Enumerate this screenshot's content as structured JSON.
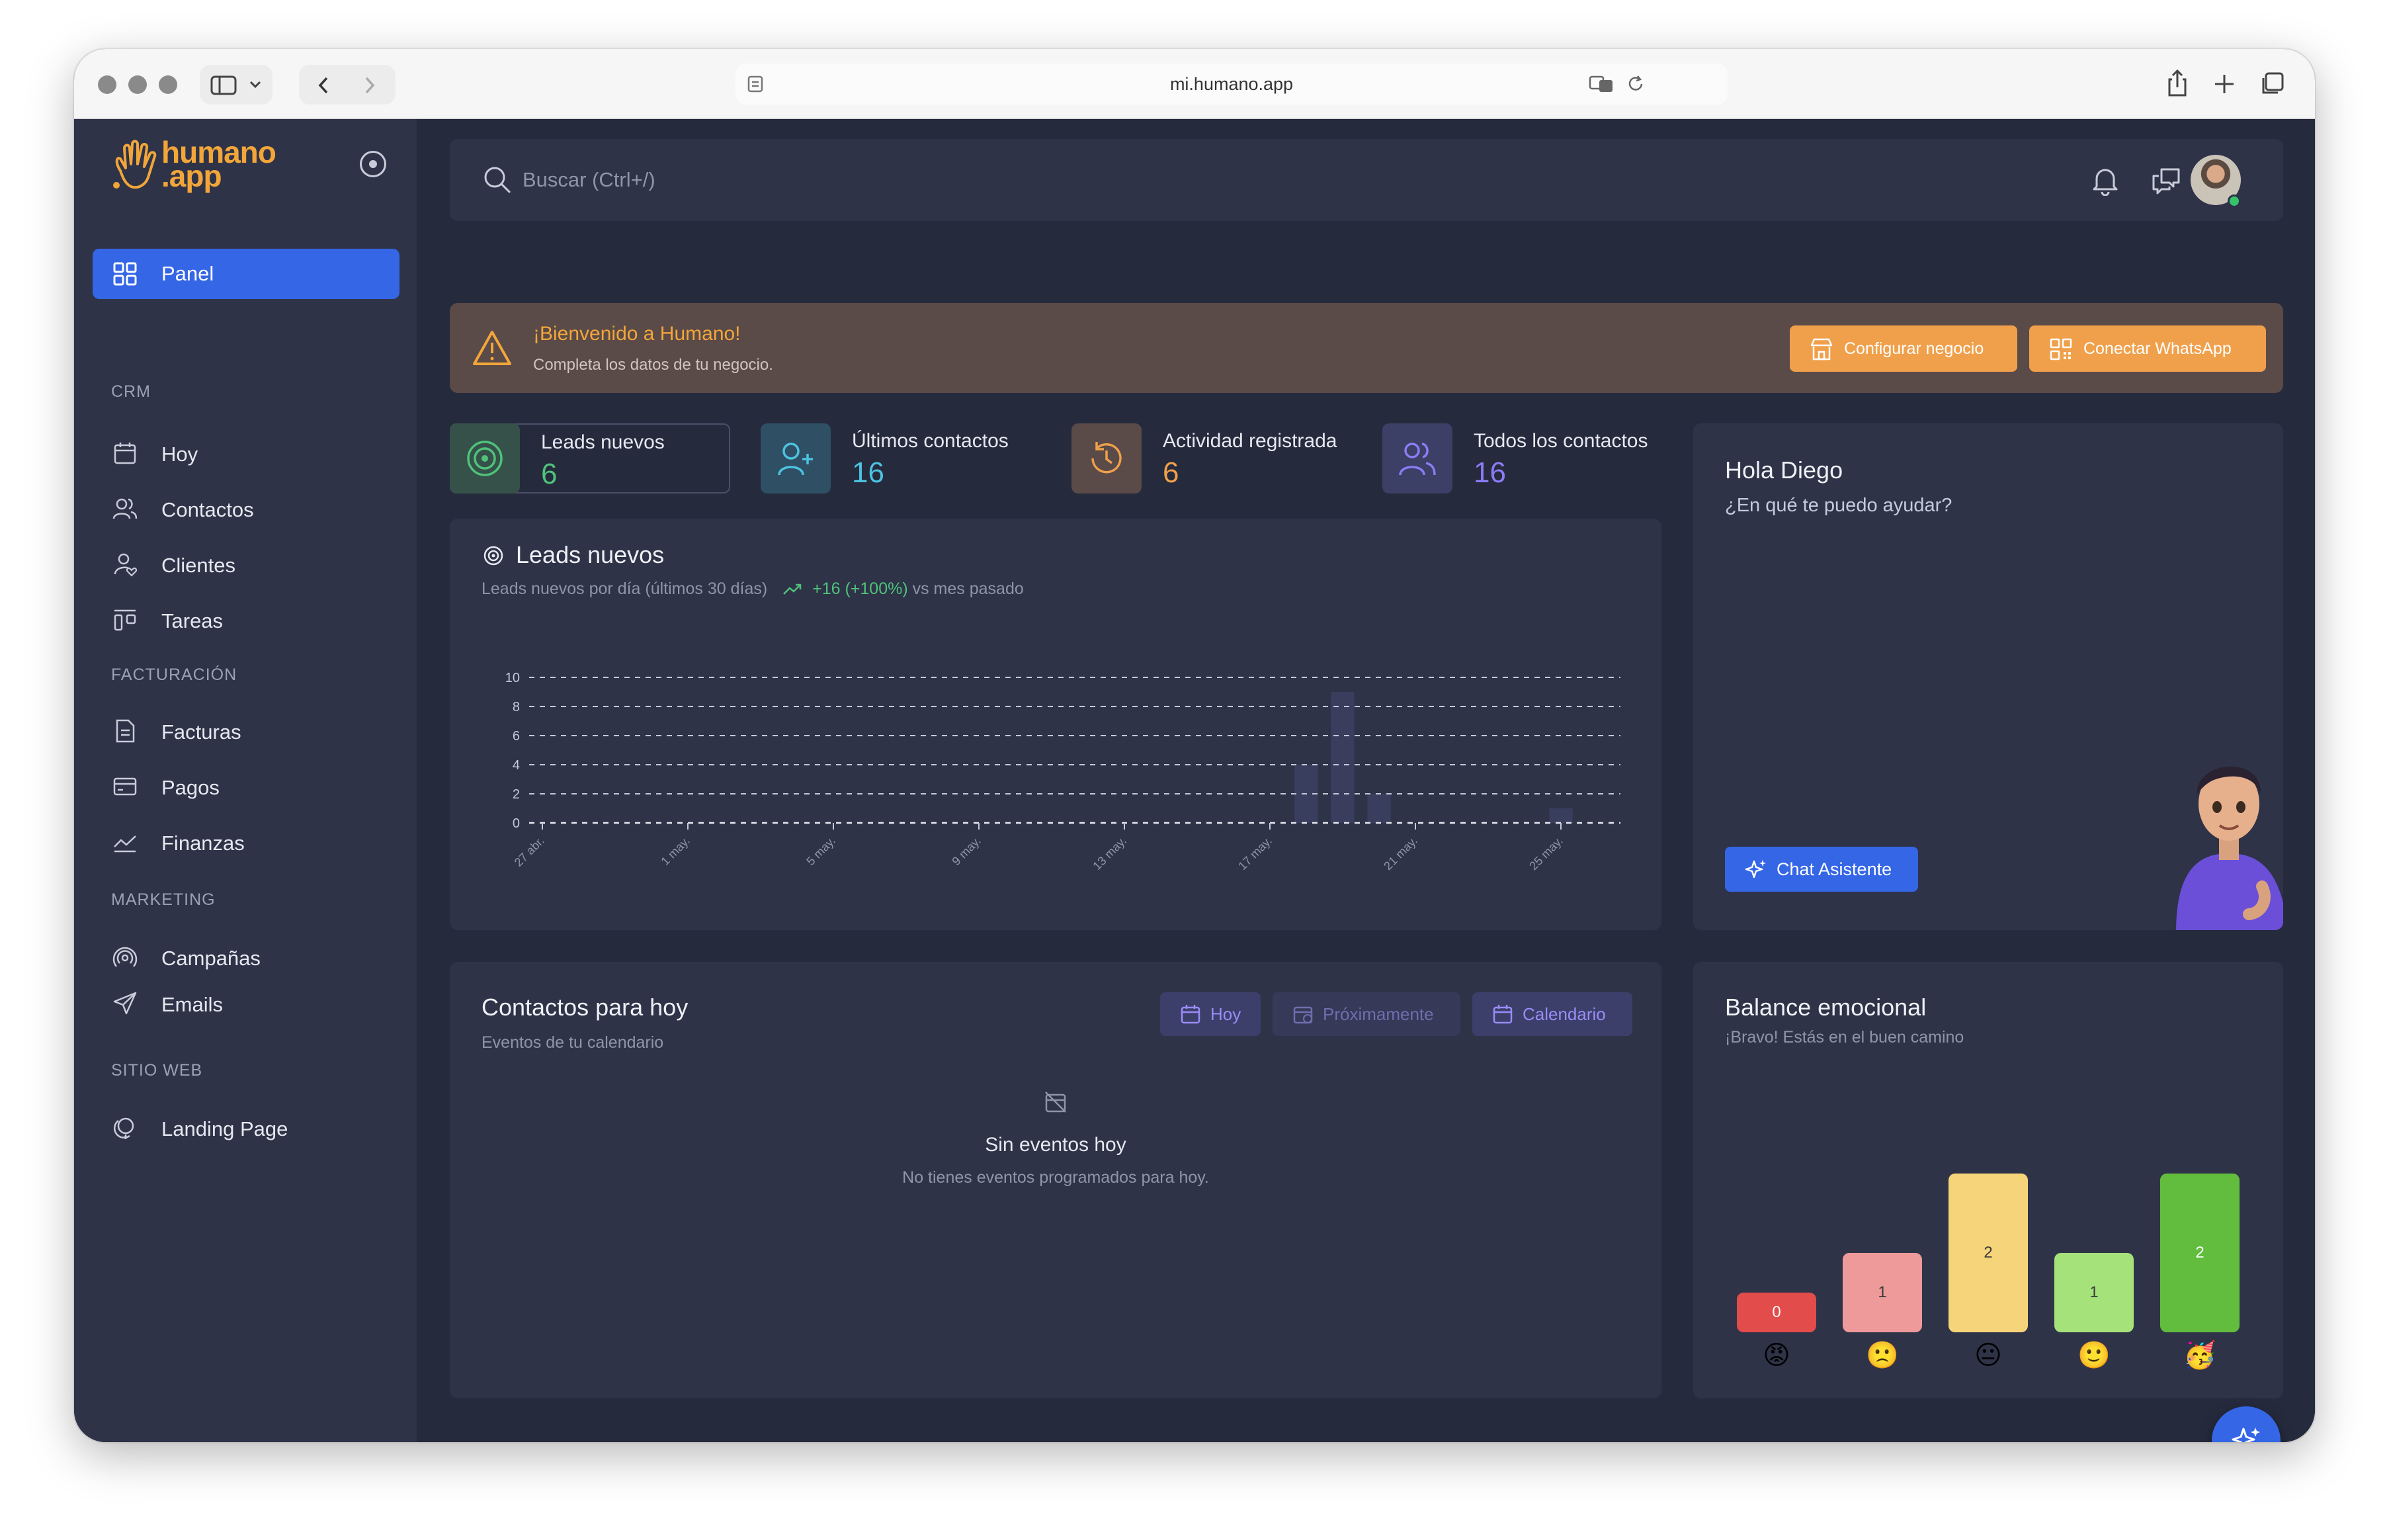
{
  "browser": {
    "url": "mi.humano.app"
  },
  "brand": {
    "name_line1": "humano",
    "name_line2": ".app",
    "accent_color": "#f2a63a"
  },
  "sidebar": {
    "active": {
      "label": "Panel",
      "icon": "grid-icon"
    },
    "sections": [
      {
        "title": "CRM",
        "items": [
          {
            "label": "Hoy",
            "icon": "calendar-icon"
          },
          {
            "label": "Contactos",
            "icon": "users-icon"
          },
          {
            "label": "Clientes",
            "icon": "user-heart-icon"
          },
          {
            "label": "Tareas",
            "icon": "tasks-icon"
          }
        ]
      },
      {
        "title": "FACTURACIÓN",
        "items": [
          {
            "label": "Facturas",
            "icon": "invoice-icon"
          },
          {
            "label": "Pagos",
            "icon": "credit-card-icon"
          },
          {
            "label": "Finanzas",
            "icon": "trend-icon"
          }
        ]
      },
      {
        "title": "MARKETING",
        "items": [
          {
            "label": "Campañas",
            "icon": "broadcast-icon"
          },
          {
            "label": "Emails",
            "icon": "send-icon"
          }
        ]
      },
      {
        "title": "SITIO WEB",
        "items": [
          {
            "label": "Landing Page",
            "icon": "globe-icon"
          }
        ]
      }
    ]
  },
  "topbar": {
    "search_placeholder": "Buscar (Ctrl+/)"
  },
  "alert": {
    "title": "¡Bienvenido a Humano!",
    "subtitle": "Completa los datos de tu negocio.",
    "btn_config": "Configurar negocio",
    "btn_whatsapp": "Conectar WhatsApp"
  },
  "stats": [
    {
      "label": "Leads nuevos",
      "value": "6",
      "color": "#4fc27a"
    },
    {
      "label": "Últimos contactos",
      "value": "16",
      "color": "#4cc3e0"
    },
    {
      "label": "Actividad registrada",
      "value": "6",
      "color": "#f0a04b"
    },
    {
      "label": "Todos los contactos",
      "value": "16",
      "color": "#8b7cf6"
    }
  ],
  "leads_card": {
    "title": "Leads nuevos",
    "subtitle": "Leads nuevos por día (últimos 30 días)",
    "trend": "+16 (+100%)",
    "trend_suffix": "vs mes pasado"
  },
  "chart_data": {
    "type": "bar",
    "title": "Leads nuevos",
    "ylim": [
      0,
      10
    ],
    "yticks": [
      0,
      2,
      4,
      6,
      8,
      10
    ],
    "x_tick_labels": [
      "27 abr.",
      "1 may.",
      "5 may.",
      "9 may.",
      "13 may.",
      "17 may.",
      "21 may.",
      "25 may."
    ],
    "grid": true,
    "bars": [
      {
        "day_index": 21,
        "value": 4
      },
      {
        "day_index": 22,
        "value": 9
      },
      {
        "day_index": 23,
        "value": 2
      },
      {
        "day_index": 28,
        "value": 1
      }
    ]
  },
  "hola_card": {
    "title": "Hola Diego",
    "subtitle": "¿En qué te puedo ayudar?",
    "button": "Chat Asistente"
  },
  "contacts_card": {
    "title": "Contactos para hoy",
    "subtitle": "Eventos de tu calendario",
    "chips": [
      "Hoy",
      "Próximamente",
      "Calendario"
    ],
    "empty_title": "Sin eventos hoy",
    "empty_sub": "No tienes eventos programados para hoy."
  },
  "balance_card": {
    "title": "Balance emocional",
    "subtitle": "¡Bravo! Estás en el buen camino",
    "bars": [
      {
        "value": 0,
        "label": "0",
        "color": "#e24c4b",
        "emoji": "😡"
      },
      {
        "value": 1,
        "label": "1",
        "color": "#ef9a9a",
        "emoji": "🙁"
      },
      {
        "value": 2,
        "label": "2",
        "color": "#f6d57a",
        "emoji": "😐"
      },
      {
        "value": 1,
        "label": "1",
        "color": "#a6e27a",
        "emoji": "🙂"
      },
      {
        "value": 2,
        "label": "2",
        "color": "#62bd3e",
        "emoji": "🥳"
      }
    ]
  }
}
